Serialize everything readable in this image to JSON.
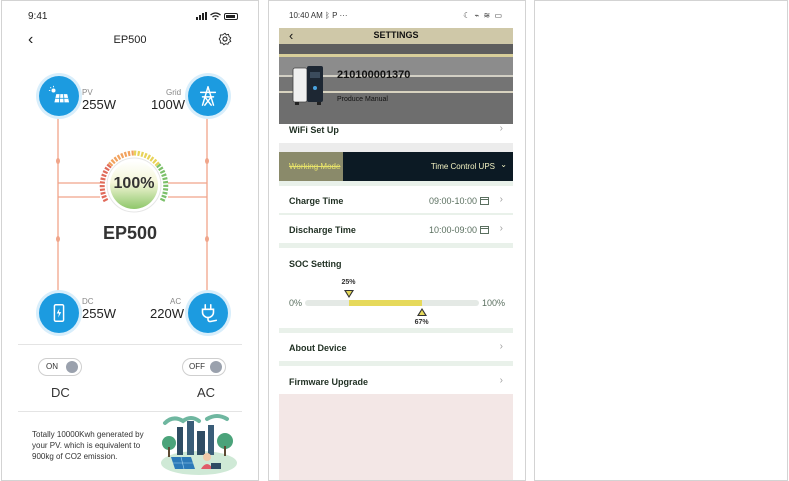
{
  "panel1": {
    "status": {
      "time": "9:41"
    },
    "nav": {
      "title": "EP500"
    },
    "nodes": {
      "pv": {
        "label": "PV",
        "value": "255W"
      },
      "grid": {
        "label": "Grid",
        "value": "100W"
      },
      "dc": {
        "label": "DC",
        "value": "255W"
      },
      "ac": {
        "label": "AC",
        "value": "220W"
      }
    },
    "gauge": {
      "percent_text": "100%",
      "level": 1.0
    },
    "device_name": "EP500",
    "toggles": [
      {
        "state": "ON",
        "label": "DC"
      },
      {
        "state": "OFF",
        "label": "AC"
      }
    ],
    "eco_text": "Totally 10000Kwh generated by your PV. which is equivalent to 900kg of CO2 emission.",
    "colors": {
      "accent": "#1c9be0",
      "flow": "#f0a58a"
    }
  },
  "panel2": {
    "status": {
      "time": "10:40 AM",
      "extra": "P ···",
      "right": "☾ ⌁ ≋ ▭"
    },
    "header": {
      "title": "SETTINGS",
      "serial": "210100001370",
      "manual": "Produce Manual"
    },
    "wifi": {
      "label": "WiFi Set Up"
    },
    "working_mode": {
      "label": "Working Mode",
      "value": "Time Control UPS"
    },
    "charge_time": {
      "label": "Charge Time",
      "value": "09:00-10:00"
    },
    "discharge_time": {
      "label": "Discharge Time",
      "value": "10:00-09:00"
    },
    "soc": {
      "title": "SOC Setting",
      "min_label": "0%",
      "max_label": "100%",
      "low": {
        "label": "25%",
        "value": 25
      },
      "high": {
        "label": "67%",
        "value": 67
      }
    },
    "about": {
      "label": "About Device"
    },
    "firmware": {
      "label": "Firmware Upgrade"
    }
  }
}
